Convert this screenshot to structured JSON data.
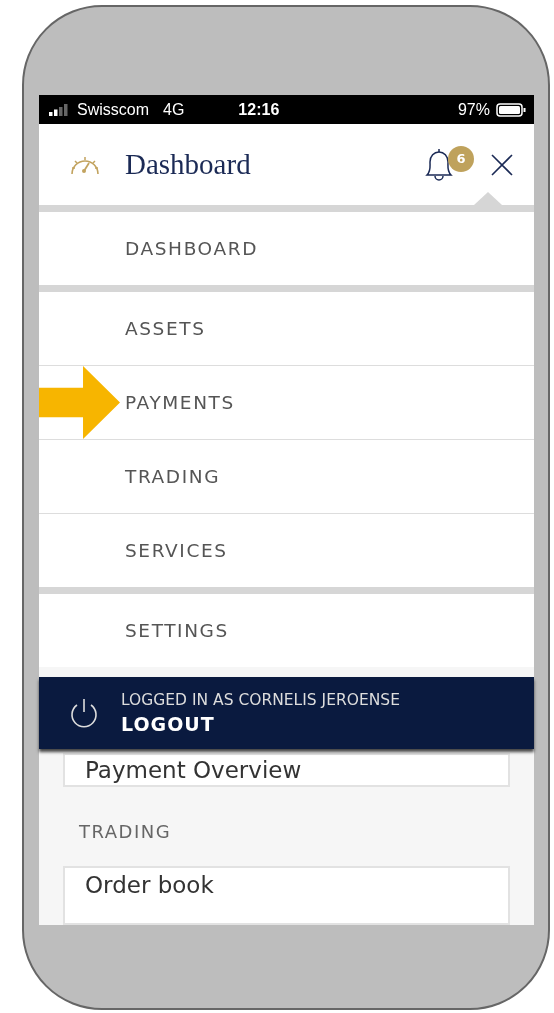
{
  "status_bar": {
    "carrier": "Swisscom",
    "network": "4G",
    "time": "12:16",
    "battery": "97%"
  },
  "header": {
    "title": "Dashboard",
    "notification_count": "6"
  },
  "menu": {
    "groups": [
      [
        {
          "label": "DASHBOARD",
          "highlighted": false
        }
      ],
      [
        {
          "label": "ASSETS",
          "highlighted": false
        },
        {
          "label": "PAYMENTS",
          "highlighted": true
        },
        {
          "label": "TRADING",
          "highlighted": false
        },
        {
          "label": "SERVICES",
          "highlighted": false
        }
      ],
      [
        {
          "label": "SETTINGS",
          "highlighted": false
        }
      ]
    ]
  },
  "logout_bar": {
    "user_line": "LOGGED IN AS CORNELIS JEROENSE",
    "button": "LOGOUT"
  },
  "background_page": [
    {
      "kind": "card",
      "title": "Payment Overview"
    },
    {
      "kind": "section",
      "title": "TRADING"
    },
    {
      "kind": "card",
      "title": "Order book"
    }
  ]
}
